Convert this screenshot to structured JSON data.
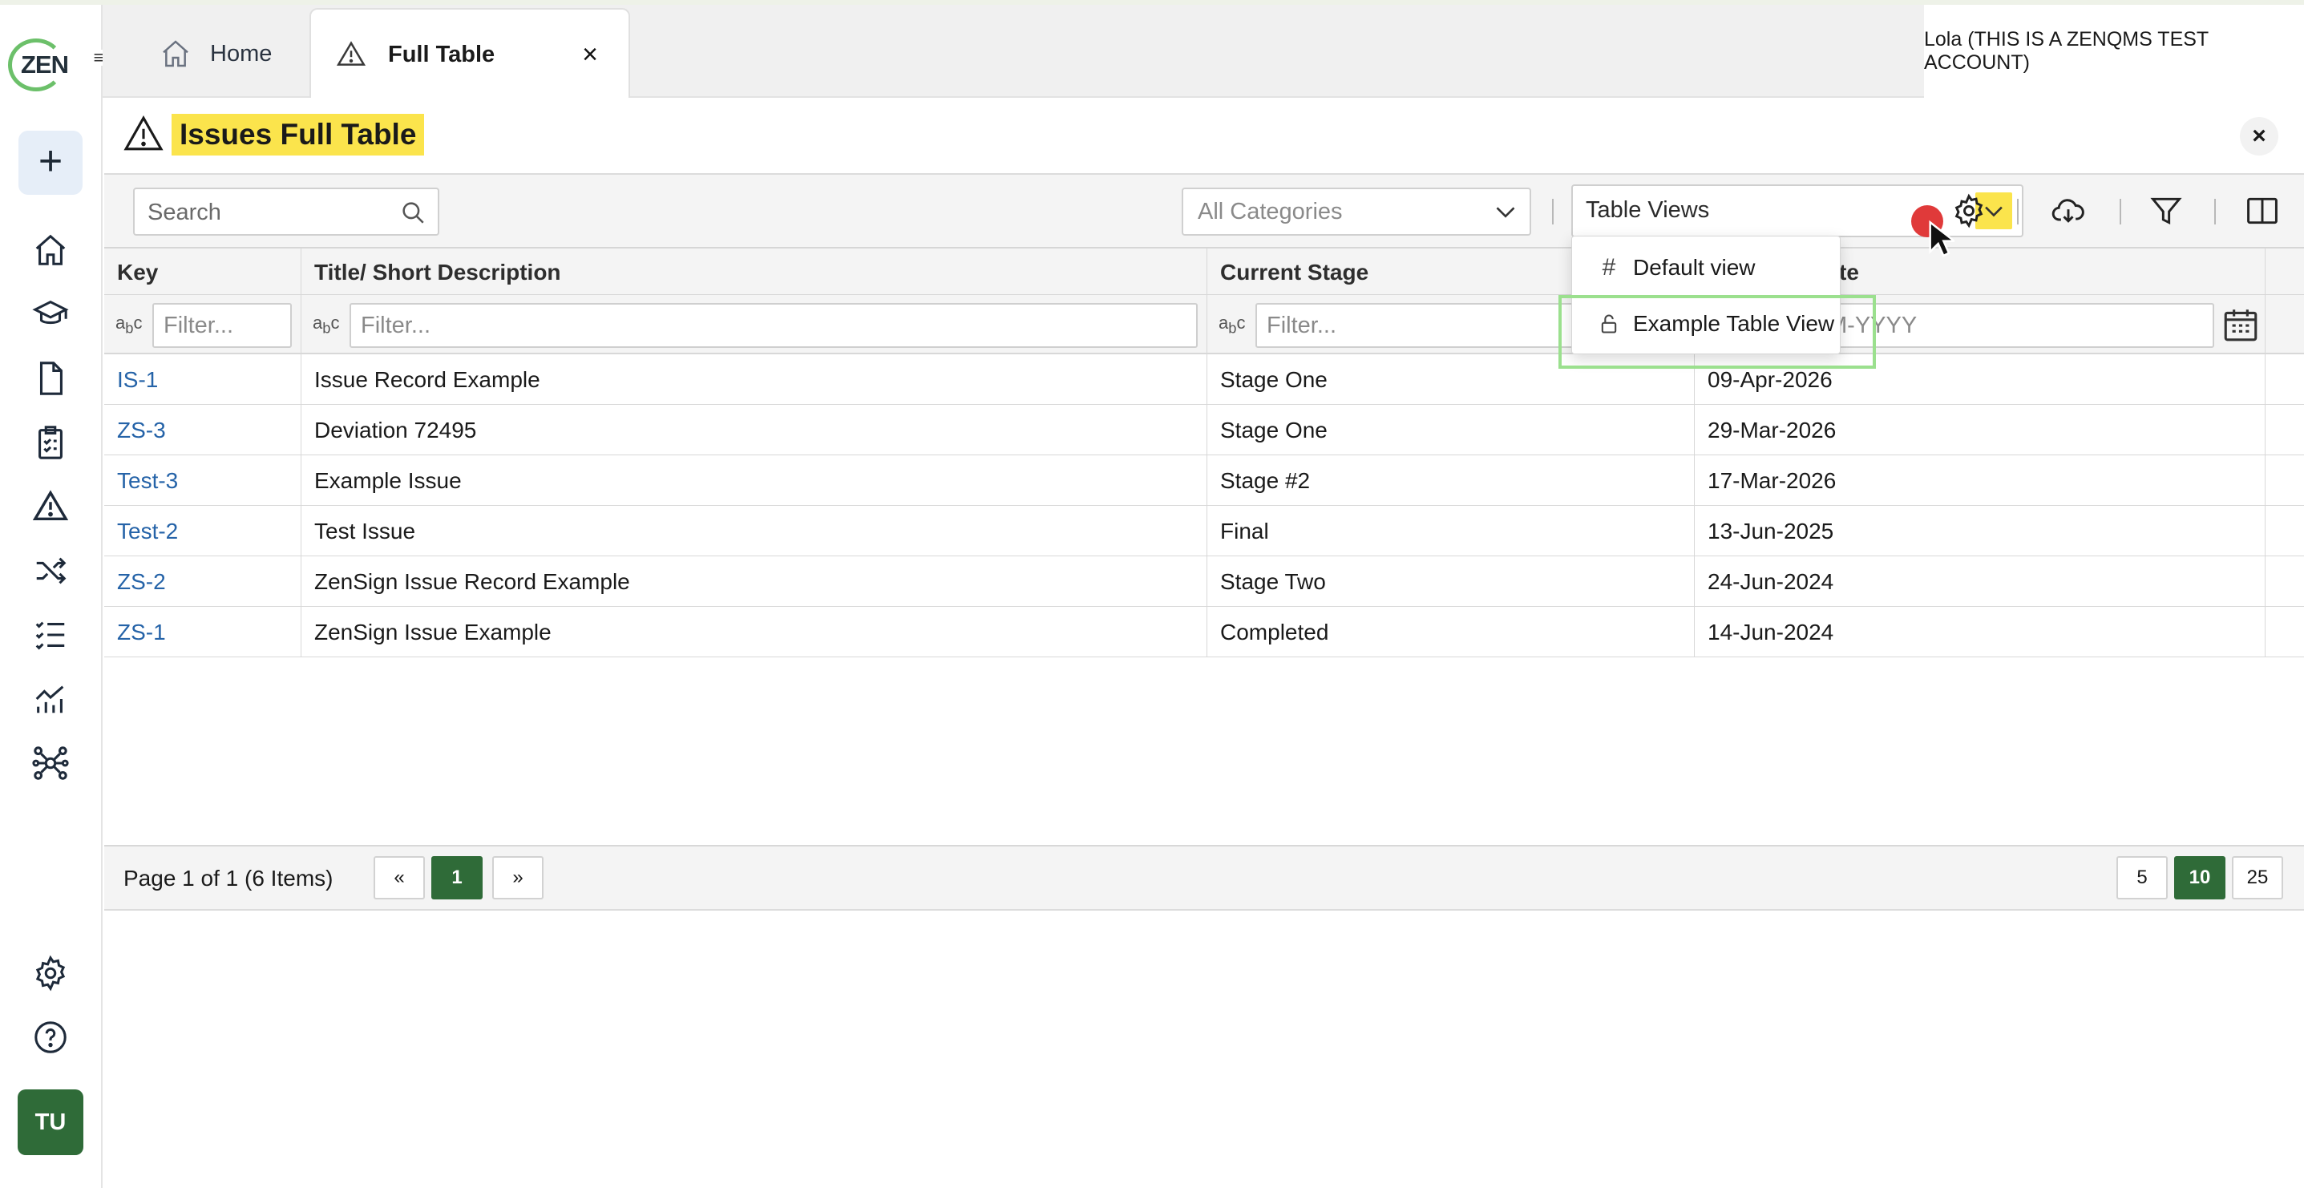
{
  "logo_text": "ZEN",
  "tabs": [
    {
      "label": "Home",
      "icon": "home-icon"
    },
    {
      "label": "Full Table",
      "icon": "warning-icon",
      "close": "×"
    }
  ],
  "account": "Lola (THIS IS A ZENQMS TEST ACCOUNT)",
  "rail": {
    "add": "+",
    "avatar": "TU",
    "icons": [
      "home-icon",
      "training-icon",
      "document-icon",
      "checklist-icon",
      "warning-icon",
      "shuffle-icon",
      "task-list-icon",
      "chart-icon",
      "network-icon",
      "settings-icon",
      "help-icon"
    ]
  },
  "page": {
    "title": "Issues Full Table",
    "close": "×"
  },
  "toolbar": {
    "search_placeholder": "Search",
    "category_placeholder": "All Categories",
    "views_label": "Table Views"
  },
  "dropdown": {
    "items": [
      {
        "icon": "#",
        "label": "Default view"
      },
      {
        "icon": "lock",
        "label": "Example Table View"
      }
    ]
  },
  "table": {
    "columns": [
      "Key",
      "Title/ Short Description",
      "Current Stage",
      "Due Date"
    ],
    "visible_date_header": "te",
    "filter_placeholder": "Filter...",
    "date_placeholder": "DD-MMM-YYYY",
    "date_visible_placeholder": "M-YYYY",
    "rows": [
      {
        "key": "IS-1",
        "title": "Issue Record Example",
        "stage": "Stage One",
        "date": "09-Apr-2026"
      },
      {
        "key": "ZS-3",
        "title": "Deviation 72495",
        "stage": "Stage One",
        "date": "29-Mar-2026"
      },
      {
        "key": "Test-3",
        "title": "Example Issue",
        "stage": "Stage #2",
        "date": "17-Mar-2026"
      },
      {
        "key": "Test-2",
        "title": "Test Issue",
        "stage": "Final",
        "date": "13-Jun-2025"
      },
      {
        "key": "ZS-2",
        "title": "ZenSign Issue Record Example",
        "stage": "Stage Two",
        "date": "24-Jun-2024"
      },
      {
        "key": "ZS-1",
        "title": "ZenSign Issue Example",
        "stage": "Completed",
        "date": "14-Jun-2024"
      }
    ]
  },
  "pager": {
    "summary": "Page 1 of 1 (6 Items)",
    "prev": "«",
    "current": "1",
    "next": "»",
    "sizes": [
      "5",
      "10",
      "25"
    ],
    "active_size": "10"
  },
  "colors": {
    "accent_green": "#2f6b38",
    "highlight_yellow": "#fbe44c",
    "link_blue": "#2563a8"
  }
}
